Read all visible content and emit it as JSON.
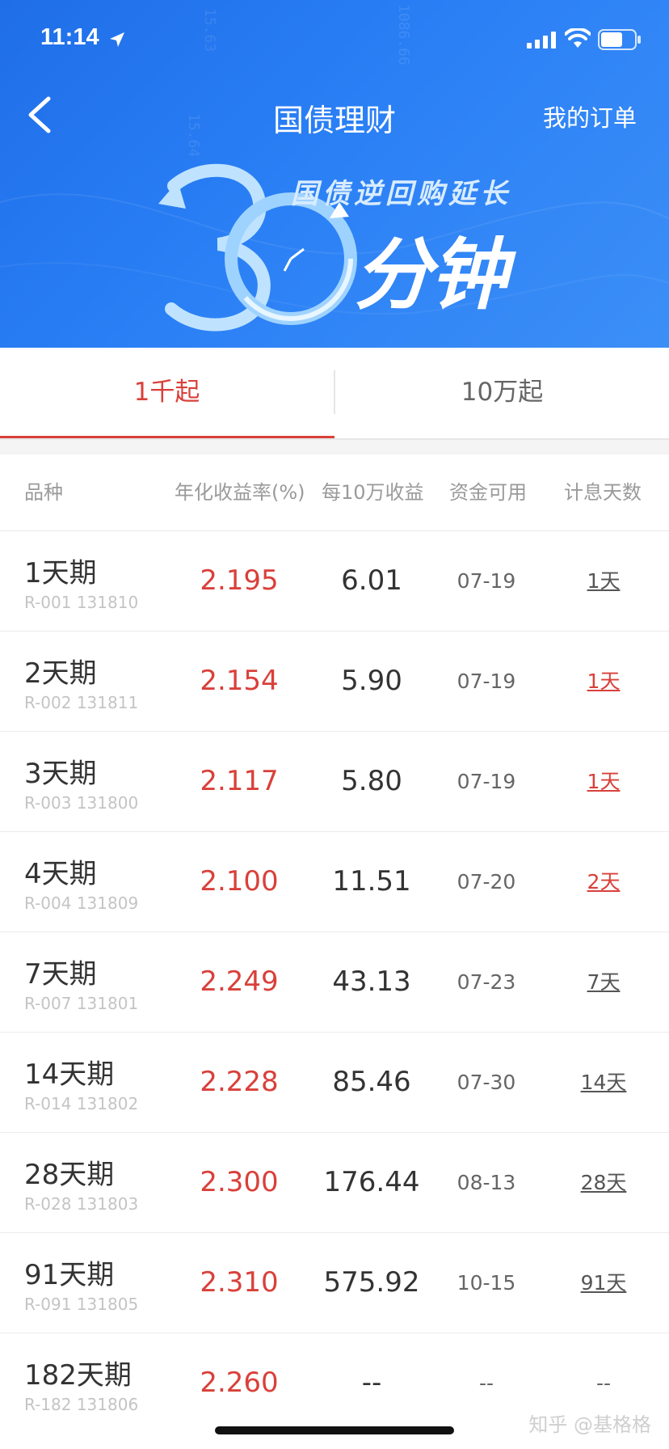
{
  "status_bar": {
    "time": "11:14"
  },
  "nav": {
    "title": "国债理财",
    "right_link": "我的订单"
  },
  "banner": {
    "subtitle": "国债逆回购延长",
    "main": "分钟"
  },
  "tabs": [
    {
      "label": "1千起",
      "active": true
    },
    {
      "label": "10万起",
      "active": false
    }
  ],
  "table": {
    "headers": [
      "品种",
      "年化收益率(%)",
      "每10万收益",
      "资金可用",
      "计息天数"
    ],
    "rows": [
      {
        "name": "1天期",
        "code": "R-001 131810",
        "rate": "2.195",
        "income": "6.01",
        "available": "07-19",
        "days": "1天",
        "days_color": "gray"
      },
      {
        "name": "2天期",
        "code": "R-002 131811",
        "rate": "2.154",
        "income": "5.90",
        "available": "07-19",
        "days": "1天",
        "days_color": "red"
      },
      {
        "name": "3天期",
        "code": "R-003 131800",
        "rate": "2.117",
        "income": "5.80",
        "available": "07-19",
        "days": "1天",
        "days_color": "red"
      },
      {
        "name": "4天期",
        "code": "R-004 131809",
        "rate": "2.100",
        "income": "11.51",
        "available": "07-20",
        "days": "2天",
        "days_color": "red"
      },
      {
        "name": "7天期",
        "code": "R-007 131801",
        "rate": "2.249",
        "income": "43.13",
        "available": "07-23",
        "days": "7天",
        "days_color": "gray"
      },
      {
        "name": "14天期",
        "code": "R-014 131802",
        "rate": "2.228",
        "income": "85.46",
        "available": "07-30",
        "days": "14天",
        "days_color": "gray"
      },
      {
        "name": "28天期",
        "code": "R-028 131803",
        "rate": "2.300",
        "income": "176.44",
        "available": "08-13",
        "days": "28天",
        "days_color": "gray"
      },
      {
        "name": "91天期",
        "code": "R-091 131805",
        "rate": "2.310",
        "income": "575.92",
        "available": "10-15",
        "days": "91天",
        "days_color": "gray"
      },
      {
        "name": "182天期",
        "code": "R-182 131806",
        "rate": "2.260",
        "income": "--",
        "available": "--",
        "days": "--",
        "days_color": "none"
      }
    ]
  },
  "footer_watermark": "知乎 @基格格",
  "colors": {
    "primary_blue": "#2a7ff5",
    "accent_red": "#d9403a"
  }
}
